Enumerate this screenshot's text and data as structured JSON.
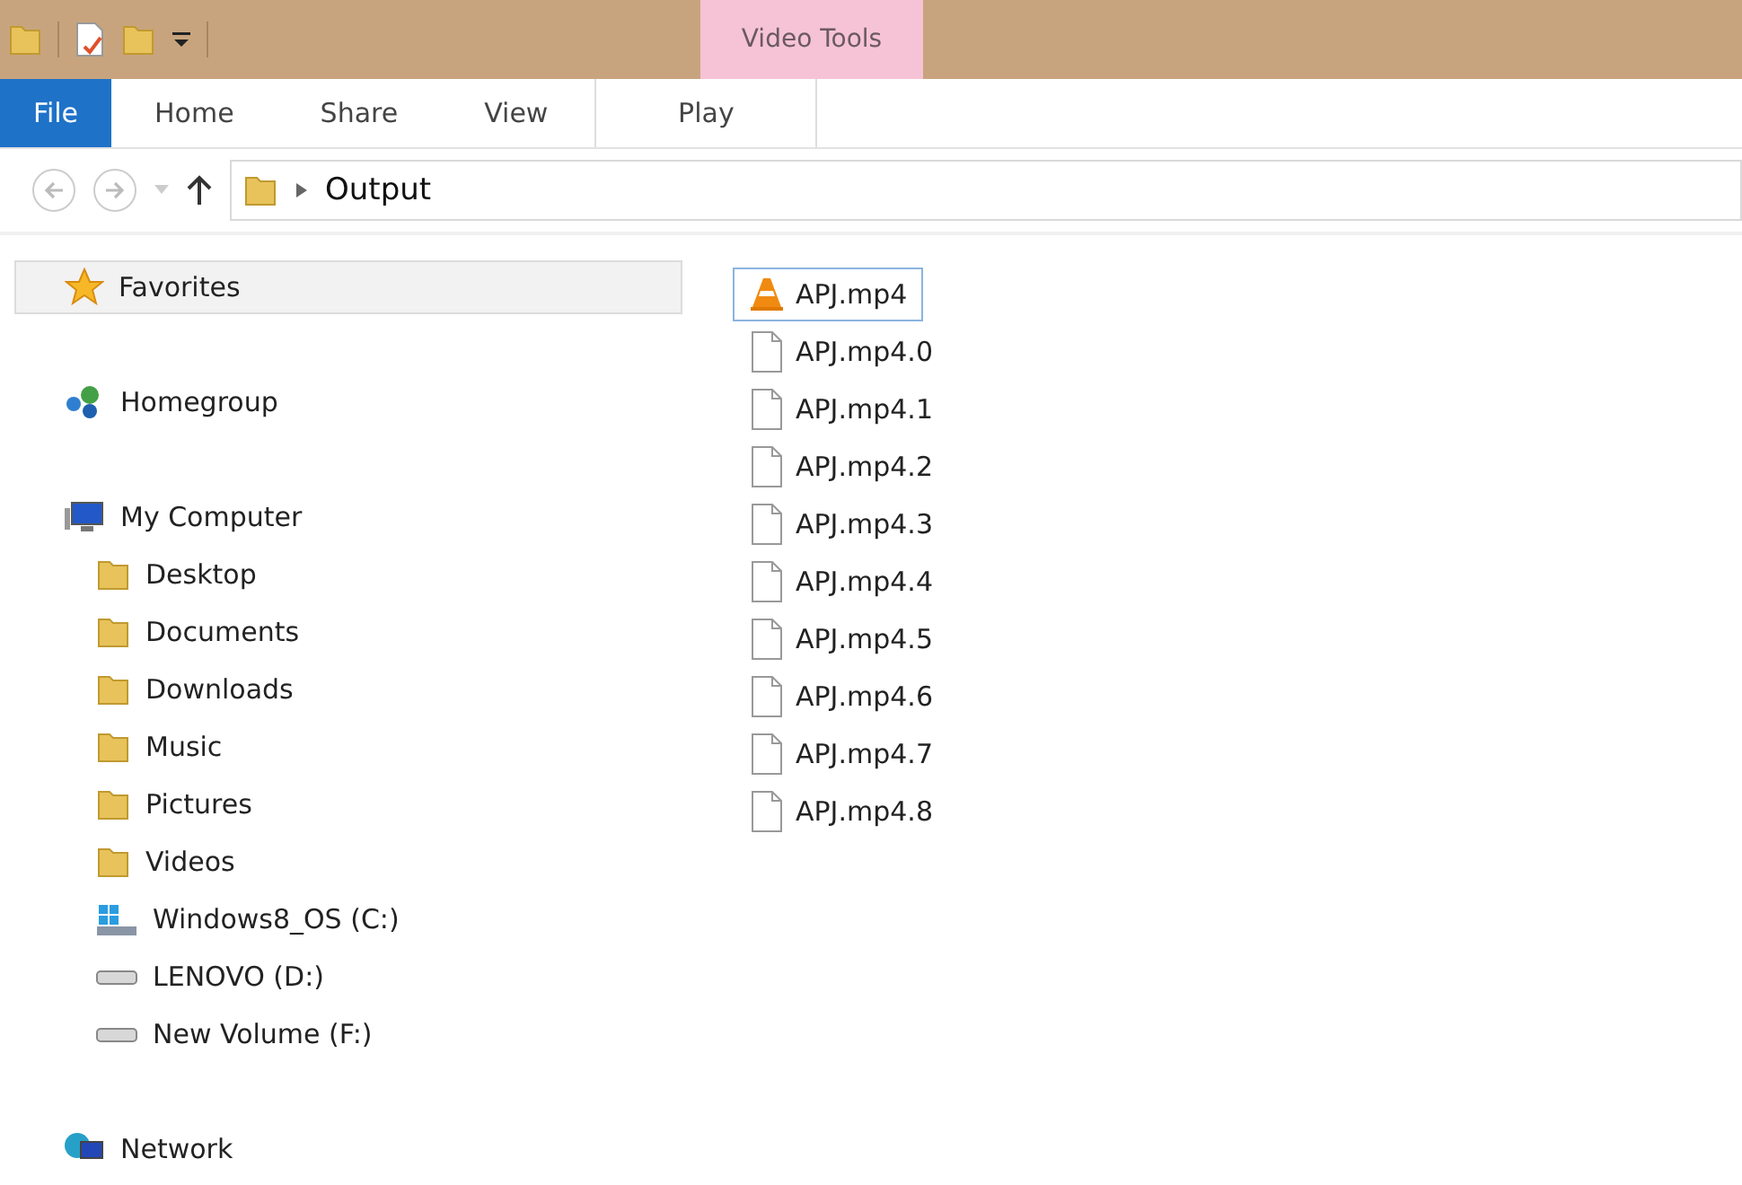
{
  "title_bar": {
    "context_label": "Video Tools"
  },
  "ribbon_tabs": [
    {
      "label": "File",
      "kind": "file"
    },
    {
      "label": "Home",
      "kind": "normal"
    },
    {
      "label": "Share",
      "kind": "normal"
    },
    {
      "label": "View",
      "kind": "normal"
    },
    {
      "label": "Play",
      "kind": "contextual"
    }
  ],
  "address_bar": {
    "path": "Output"
  },
  "sidebar": {
    "items": [
      {
        "label": "Favorites",
        "kind": "star",
        "selected": true
      },
      {
        "label": "Homegroup",
        "kind": "homegroup",
        "selected": false
      },
      {
        "label": "My Computer",
        "kind": "computer",
        "selected": false,
        "children": [
          {
            "label": "Desktop",
            "kind": "folder",
            "selected": false
          },
          {
            "label": "Documents",
            "kind": "folder",
            "selected": false
          },
          {
            "label": "Downloads",
            "kind": "folder",
            "selected": false
          },
          {
            "label": "Music",
            "kind": "folder",
            "selected": false
          },
          {
            "label": "Pictures",
            "kind": "folder",
            "selected": false
          },
          {
            "label": "Videos",
            "kind": "folder",
            "selected": false
          },
          {
            "label": "Windows8_OS (C:)",
            "kind": "windrive",
            "selected": false
          },
          {
            "label": "LENOVO (D:)",
            "kind": "drive",
            "selected": false
          },
          {
            "label": "New Volume (F:)",
            "kind": "drive",
            "selected": false
          }
        ]
      },
      {
        "label": "Network",
        "kind": "network",
        "selected": false
      }
    ]
  },
  "files": [
    {
      "name": "APJ.mp4",
      "kind": "video",
      "selected": true
    },
    {
      "name": "APJ.mp4.0",
      "kind": "file",
      "selected": false
    },
    {
      "name": "APJ.mp4.1",
      "kind": "file",
      "selected": false
    },
    {
      "name": "APJ.mp4.2",
      "kind": "file",
      "selected": false
    },
    {
      "name": "APJ.mp4.3",
      "kind": "file",
      "selected": false
    },
    {
      "name": "APJ.mp4.4",
      "kind": "file",
      "selected": false
    },
    {
      "name": "APJ.mp4.5",
      "kind": "file",
      "selected": false
    },
    {
      "name": "APJ.mp4.6",
      "kind": "file",
      "selected": false
    },
    {
      "name": "APJ.mp4.7",
      "kind": "file",
      "selected": false
    },
    {
      "name": "APJ.mp4.8",
      "kind": "file",
      "selected": false
    }
  ]
}
